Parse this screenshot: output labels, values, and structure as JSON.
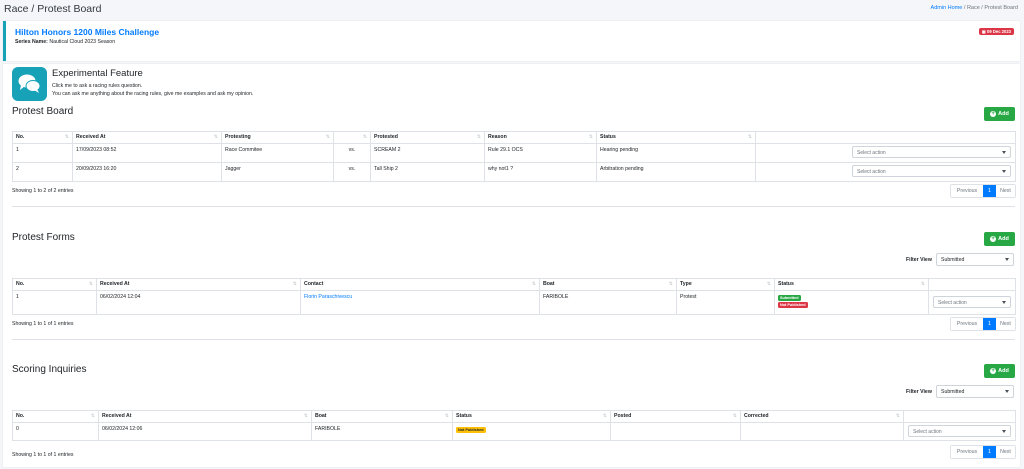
{
  "header": {
    "title": "Race / Protest Board",
    "breadcrumb_home": "Admin Home",
    "breadcrumb_sep": "/",
    "breadcrumb_current": "Race / Protest Board"
  },
  "event": {
    "title": "Hilton Honors 1200 Miles Challenge",
    "series_label": "Series Name:",
    "series_value": "Nautical Cloud 2023 Season",
    "date_badge": "09 Dec 2023"
  },
  "experimental": {
    "title": "Experimental Feature",
    "line1": "Click me to ask a racing rules question.",
    "line2": "You can ask me anything about the racing rules, give me examples and ask my opinion."
  },
  "protest_board": {
    "title": "Protest Board",
    "add_label": "Add",
    "columns": [
      "No.",
      "Received At",
      "Protesting",
      "",
      "Protested",
      "Reason",
      "Status",
      ""
    ],
    "rows": [
      {
        "no": "1",
        "received": "17/09/2023 08:52",
        "protesting": "Race Commitee",
        "vs": "vs.",
        "protested": "SCREAM 2",
        "reason": "Rule 29.1 OCS",
        "status": "Hearing pending",
        "action": "Select action"
      },
      {
        "no": "2",
        "received": "20/09/2023 16:20",
        "protesting": "Jagger",
        "vs": "vs.",
        "protested": "Tall Ship 2",
        "reason": "why not1 ?",
        "status": "Arbitration pending",
        "action": "Select action"
      }
    ],
    "showing": "Showing 1 to 2 of 2 entries",
    "pager": {
      "prev": "Previous",
      "page": "1",
      "next": "Next"
    }
  },
  "protest_forms": {
    "title": "Protest Forms",
    "add_label": "Add",
    "filter_label": "Filter View",
    "filter_value": "Submitted",
    "columns": [
      "No.",
      "Received At",
      "Contact",
      "Boat",
      "Type",
      "Status",
      ""
    ],
    "rows": [
      {
        "no": "1",
        "received": "06/02/2024 12:04",
        "contact": "Florin Paraschivescu",
        "boat": "FARIBOLE",
        "type": "Protest",
        "badge1": "Submitted",
        "badge2": "Not Published",
        "action": "Select action"
      }
    ],
    "showing": "Showing 1 to 1 of 1 entries",
    "pager": {
      "prev": "Previous",
      "page": "1",
      "next": "Next"
    }
  },
  "scoring_inquiries": {
    "title": "Scoring Inquiries",
    "add_label": "Add",
    "filter_label": "Filter View",
    "filter_value": "Submitted",
    "columns": [
      "No.",
      "Received At",
      "Boat",
      "Status",
      "Posted",
      "Corrected",
      ""
    ],
    "rows": [
      {
        "no": "0",
        "received": "06/02/2024 12:06",
        "boat": "FARIBOLE",
        "badge": "Not Published",
        "posted": "",
        "corrected": "",
        "action": "Select action"
      }
    ],
    "showing": "Showing 1 to 1 of 1 entries",
    "pager": {
      "prev": "Previous",
      "page": "1",
      "next": "Next"
    }
  },
  "colors": {
    "accent": "#17a2b8",
    "primary": "#007bff",
    "success": "#28a745",
    "danger": "#dc3545",
    "warning": "#ffc107"
  },
  "icons": {
    "experimental": "chat-bubbles-icon",
    "add": "plus-circle-icon",
    "sort": "sort-icon",
    "dropdown": "caret-down-icon",
    "calendar": "calendar-icon"
  }
}
